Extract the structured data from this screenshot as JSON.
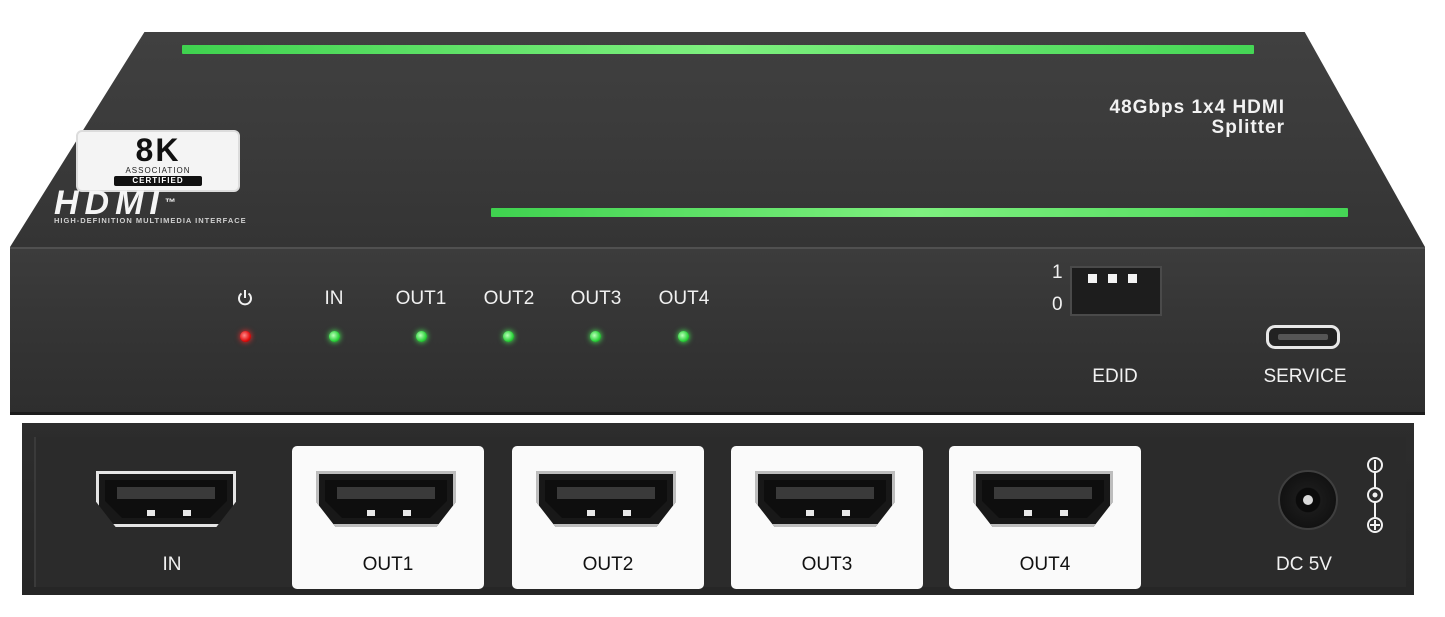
{
  "product": {
    "title_line1": "48Gbps 1x4 HDMI",
    "title_line2": "Splitter"
  },
  "certification": {
    "badge_big": "8K",
    "badge_assoc": "ASSOCIATION",
    "badge_cert": "CERTIFIED",
    "logo": "HDMI",
    "trademark": "™",
    "tagline": "HIGH-DEFINITION MULTIMEDIA INTERFACE"
  },
  "indicators": [
    {
      "label": "IN",
      "color": "green"
    },
    {
      "label": "OUT1",
      "color": "green"
    },
    {
      "label": "OUT2",
      "color": "green"
    },
    {
      "label": "OUT3",
      "color": "green"
    },
    {
      "label": "OUT4",
      "color": "green"
    }
  ],
  "power_indicator": {
    "icon": "power-icon",
    "color": "red"
  },
  "edid": {
    "label": "EDID",
    "position_high": "1",
    "position_low": "0",
    "switch_count": 3
  },
  "service": {
    "label": "SERVICE"
  },
  "ports": {
    "input": "IN",
    "outputs": [
      "OUT1",
      "OUT2",
      "OUT3",
      "OUT4"
    ],
    "dc": "DC 5V"
  },
  "colors": {
    "accent_stripe": "#3fd24f",
    "led_green": "#2bd23a",
    "led_red": "#e10d0d",
    "chassis": "#3a3a3a"
  }
}
